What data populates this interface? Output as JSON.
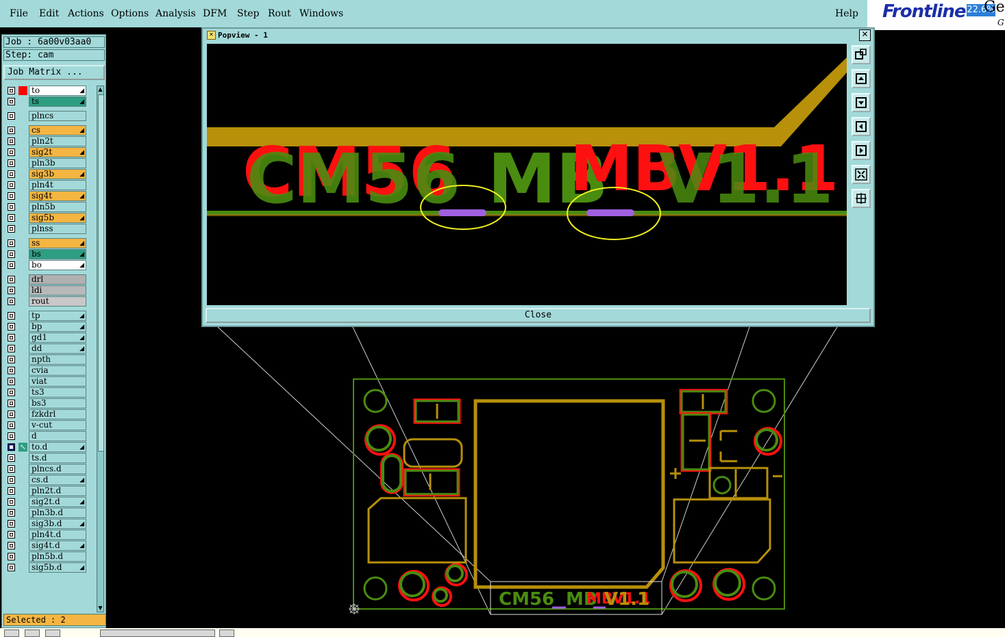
{
  "menu": {
    "items": [
      "File",
      "Edit",
      "Actions",
      "Options",
      "Analysis",
      "DFM",
      "Step",
      "Rout",
      "Windows"
    ],
    "help": "Help"
  },
  "logo": {
    "brand": "Frontline",
    "zoom": "22.6%",
    "ge": "Ge",
    "g2": "G"
  },
  "job": {
    "job_label": "Job : 6a00v03aa0",
    "step_label": "Step: cam",
    "matrix_button": "Job Matrix ..."
  },
  "layers": [
    {
      "name": "to",
      "color": "#ffffff",
      "mark": "#ff0000",
      "drop": true
    },
    {
      "name": "ts",
      "color": "#2e9e82",
      "drop": true
    },
    {
      "name": "plncs",
      "color": "#a3d9d9",
      "drop": false
    },
    {
      "name": "cs",
      "color": "#f5b542",
      "drop": true
    },
    {
      "name": "pln2t",
      "color": "#a3d9d9",
      "drop": false
    },
    {
      "name": "sig2t",
      "color": "#f5b542",
      "drop": true
    },
    {
      "name": "pln3b",
      "color": "#a3d9d9",
      "drop": false
    },
    {
      "name": "sig3b",
      "color": "#f5b542",
      "drop": true
    },
    {
      "name": "pln4t",
      "color": "#a3d9d9",
      "drop": false
    },
    {
      "name": "sig4t",
      "color": "#f5b542",
      "drop": true
    },
    {
      "name": "pln5b",
      "color": "#a3d9d9",
      "drop": false
    },
    {
      "name": "sig5b",
      "color": "#f5b542",
      "drop": true
    },
    {
      "name": "plnss",
      "color": "#a3d9d9",
      "drop": false
    },
    {
      "name": "ss",
      "color": "#f5b542",
      "drop": true
    },
    {
      "name": "bs",
      "color": "#2e9e82",
      "drop": true
    },
    {
      "name": "bo",
      "color": "#ffffff",
      "drop": true
    },
    {
      "name": "drl",
      "color": "#b0b0b0",
      "drop": false
    },
    {
      "name": "ldi",
      "color": "#b8b8b8",
      "drop": false
    },
    {
      "name": "rout",
      "color": "#c8c8c8",
      "drop": false
    },
    {
      "name": "tp",
      "color": "#a3d9d9",
      "drop": true
    },
    {
      "name": "bp",
      "color": "#a3d9d9",
      "drop": true
    },
    {
      "name": "gd1",
      "color": "#a3d9d9",
      "drop": true
    },
    {
      "name": "dd",
      "color": "#a3d9d9",
      "drop": true
    },
    {
      "name": "npth",
      "color": "#a3d9d9",
      "drop": false
    },
    {
      "name": "cvia",
      "color": "#a3d9d9",
      "drop": false
    },
    {
      "name": "viat",
      "color": "#a3d9d9",
      "drop": false
    },
    {
      "name": "ts3",
      "color": "#a3d9d9",
      "drop": false
    },
    {
      "name": "bs3",
      "color": "#a3d9d9",
      "drop": false
    },
    {
      "name": "fzkdrl",
      "color": "#a3d9d9",
      "drop": false
    },
    {
      "name": "v-cut",
      "color": "#a3d9d9",
      "drop": false
    },
    {
      "name": "d",
      "color": "#a3d9d9",
      "drop": false
    },
    {
      "name": "to.d",
      "color": "#a3d9d9",
      "drop": true,
      "active": true
    },
    {
      "name": "ts.d",
      "color": "#a3d9d9",
      "drop": false
    },
    {
      "name": "plncs.d",
      "color": "#a3d9d9",
      "drop": false
    },
    {
      "name": "cs.d",
      "color": "#a3d9d9",
      "drop": true
    },
    {
      "name": "pln2t.d",
      "color": "#a3d9d9",
      "drop": false
    },
    {
      "name": "sig2t.d",
      "color": "#a3d9d9",
      "drop": true
    },
    {
      "name": "pln3b.d",
      "color": "#a3d9d9",
      "drop": false
    },
    {
      "name": "sig3b.d",
      "color": "#a3d9d9",
      "drop": true
    },
    {
      "name": "pln4t.d",
      "color": "#a3d9d9",
      "drop": false
    },
    {
      "name": "sig4t.d",
      "color": "#a3d9d9",
      "drop": true
    },
    {
      "name": "pln5b.d",
      "color": "#a3d9d9",
      "drop": false
    },
    {
      "name": "sig5b.d",
      "color": "#a3d9d9",
      "drop": true
    }
  ],
  "selected": "Selected : 2",
  "popview": {
    "title": "Popview - 1",
    "close_button": "Close",
    "silk_text": "CM56 MBMBV1.1"
  },
  "colors": {
    "copper": "#b8900a",
    "silk_green": "#4a8c10",
    "silk_red": "#ff1010",
    "purple": "#a060e0",
    "highlight": "#f0f020",
    "panel_bg": "#a3d9d9"
  }
}
